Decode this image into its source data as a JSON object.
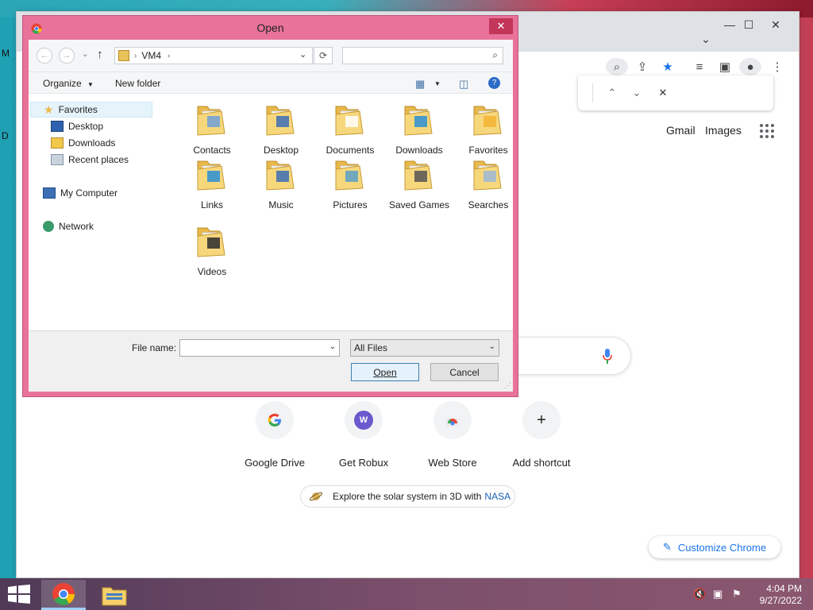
{
  "desktop": {
    "glyph_m": "M",
    "glyph_d": "D"
  },
  "chrome": {
    "find_bar": {
      "up": "⌃",
      "down": "⌄",
      "close": "✕"
    },
    "top_links": {
      "gmail": "Gmail",
      "images": "Images"
    },
    "shortcuts": [
      {
        "label": "Google Drive",
        "icon": "google-g-icon"
      },
      {
        "label": "Get Robux",
        "icon": "w-letter-icon",
        "letter": "W"
      },
      {
        "label": "Web Store",
        "icon": "webstore-icon"
      },
      {
        "label": "Add shortcut",
        "icon": "plus-icon",
        "glyph": "+"
      }
    ],
    "promo": {
      "text": "Explore the solar system in 3D with",
      "link": "NASA"
    },
    "customize": "Customize Chrome"
  },
  "dialog": {
    "title": "Open",
    "close": "✕",
    "address": {
      "path": "VM4"
    },
    "toolbar": {
      "organize": "Organize",
      "new_folder": "New folder"
    },
    "nav_pane": {
      "favorites": "Favorites",
      "desktop": "Desktop",
      "downloads": "Downloads",
      "recent": "Recent places",
      "computer": "My Computer",
      "network": "Network"
    },
    "files": [
      "Contacts",
      "Desktop",
      "Documents",
      "Downloads",
      "Favorites",
      "Links",
      "Music",
      "Pictures",
      "Saved Games",
      "Searches",
      "Videos"
    ],
    "bottom": {
      "file_name_label": "File name:",
      "file_name_value": "",
      "filter": "All Files",
      "open": "Open",
      "cancel": "Cancel"
    }
  },
  "taskbar": {
    "time": "4:04 PM",
    "date": "9/27/2022"
  },
  "colors": {
    "dialog_frame": "#e8729a",
    "accent_blue": "#1a73e8",
    "folder": "#f4cf6a"
  }
}
